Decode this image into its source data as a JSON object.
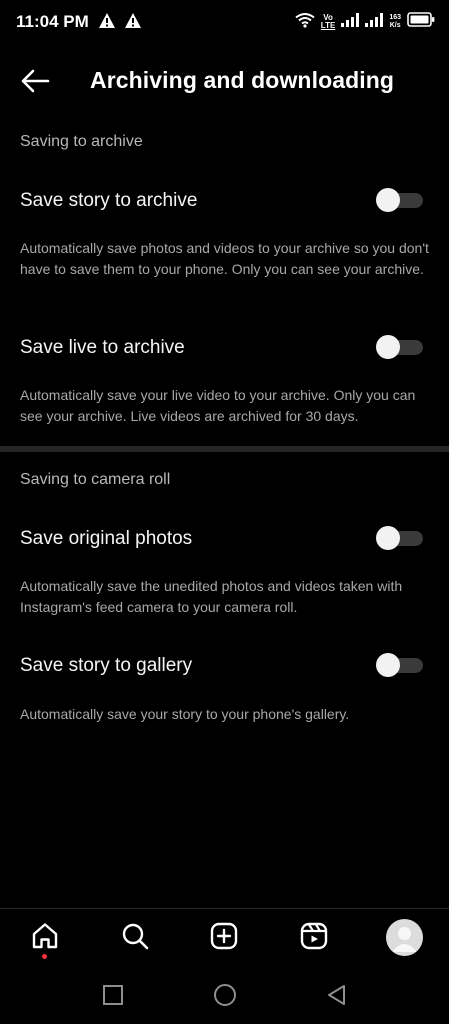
{
  "status_bar": {
    "time": "11:04 PM",
    "volte_top": "Vo",
    "volte_bottom": "LTE",
    "speed_value": "163",
    "speed_unit": "K/s",
    "icons": [
      "warning-icon",
      "warning-icon",
      "wifi-icon",
      "volte-icon",
      "signal-icon",
      "signal-icon",
      "battery-icon"
    ]
  },
  "header": {
    "title": "Archiving and downloading",
    "back_icon": "arrow-left-icon"
  },
  "sections": {
    "archive": {
      "title": "Saving to archive",
      "story": {
        "label": "Save story to archive",
        "description": "Automatically save photos and videos to your archive so you don't have to save them to your phone. Only you can see your archive.",
        "enabled": false
      },
      "live": {
        "label": "Save live to archive",
        "description": "Automatically save your live video to your archive. Only you can see your archive. Live videos are archived for 30 days.",
        "enabled": false
      }
    },
    "camera_roll": {
      "title": "Saving to camera roll",
      "original": {
        "label": "Save original photos",
        "description": "Automatically save the unedited photos and videos taken with Instagram's feed camera to your camera roll.",
        "enabled": false
      },
      "gallery": {
        "label": "Save story to gallery",
        "description": "Automatically save your story to your phone's gallery.",
        "enabled": false
      }
    }
  },
  "bottom_nav": {
    "items": [
      "home-icon",
      "search-icon",
      "create-icon",
      "reels-icon",
      "profile-avatar"
    ],
    "active": "home-icon",
    "notification_color": "#ff3040"
  },
  "system_nav": [
    "recents-icon",
    "home-circle-icon",
    "back-triangle-icon"
  ],
  "colors": {
    "background": "#000000",
    "text_primary": "#f5f5f5",
    "text_secondary": "#a8a8a8",
    "toggle_track_off": "#3a3a3a",
    "toggle_knob": "#f2f2f2"
  }
}
